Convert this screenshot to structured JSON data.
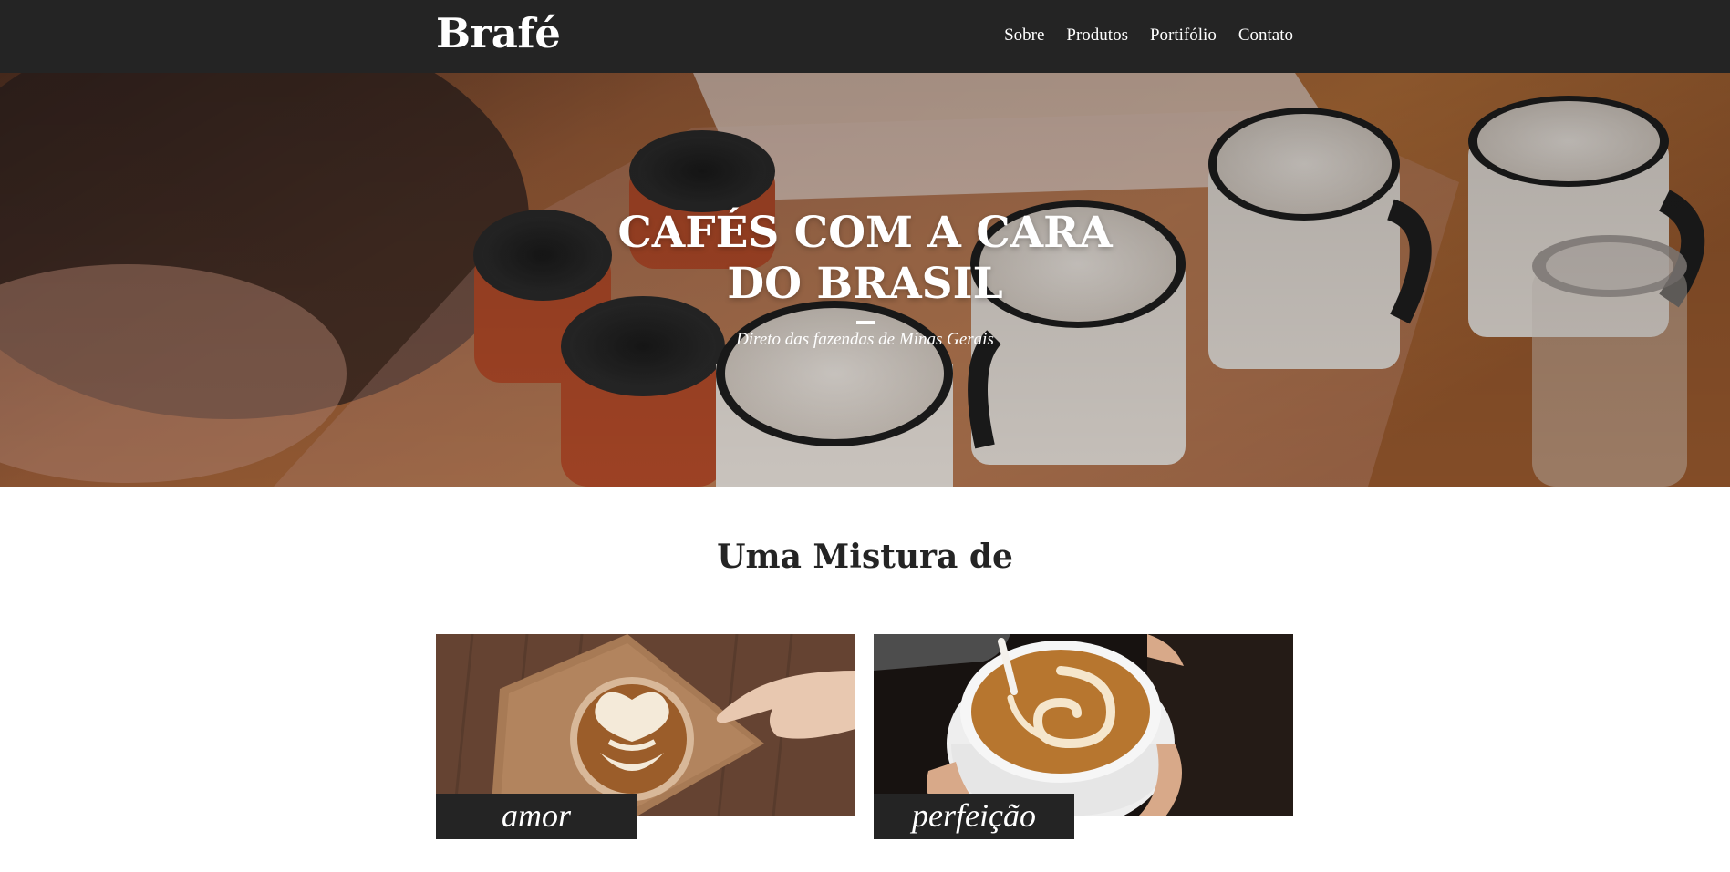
{
  "header": {
    "logo": "Brafé",
    "nav": [
      "Sobre",
      "Produtos",
      "Portifólio",
      "Contato"
    ]
  },
  "hero": {
    "title": "CAFÉS COM A CARA DO BRASIL",
    "subtitle": "Direto das fazendas de Minas Gerais"
  },
  "mix": {
    "title": "Uma Mistura de",
    "cards": [
      {
        "caption": "amor"
      },
      {
        "caption": "perfeição"
      }
    ]
  },
  "colors": {
    "header_bg": "#242424",
    "text_dark": "#242424",
    "white": "#ffffff"
  }
}
